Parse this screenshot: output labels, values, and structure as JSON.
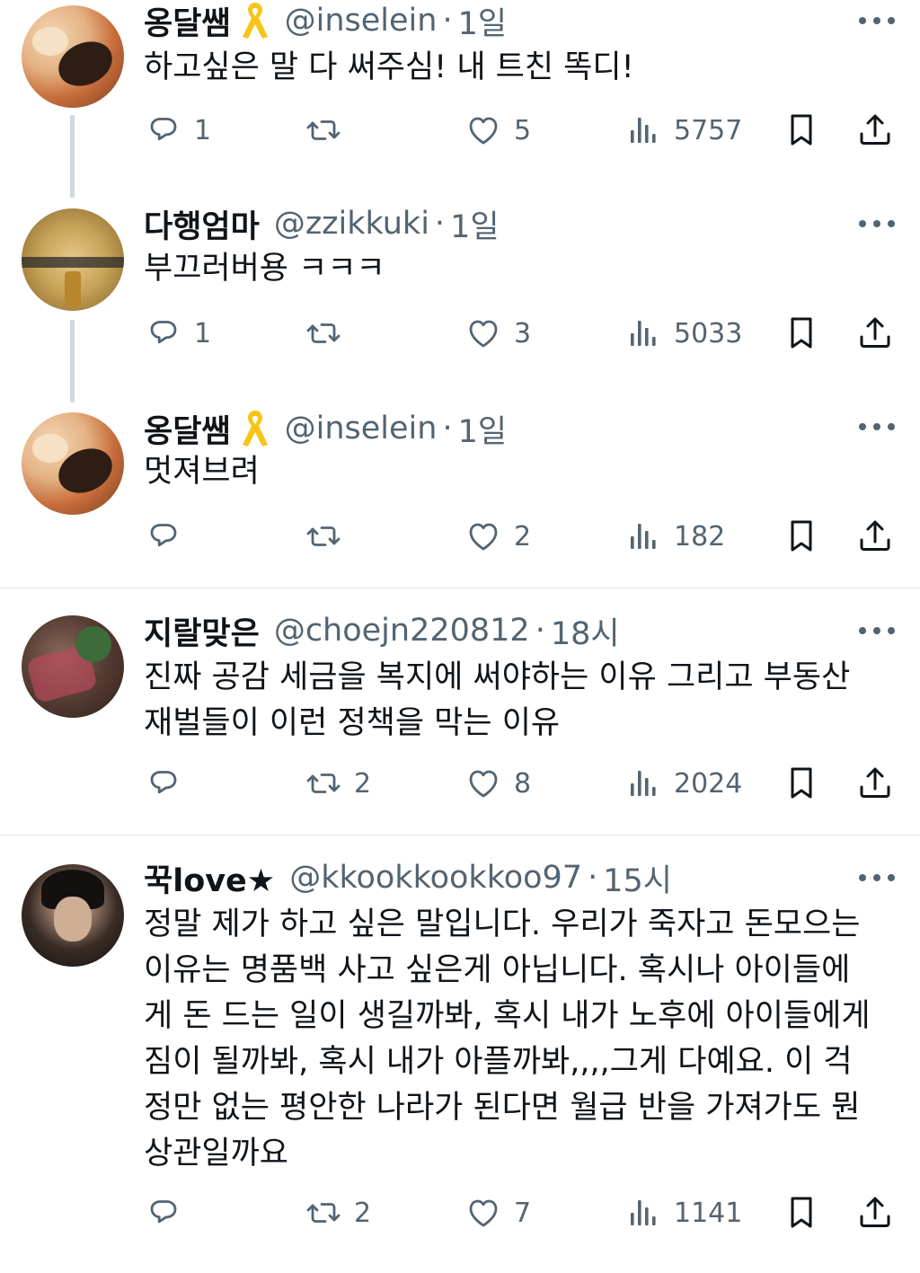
{
  "tweets": [
    {
      "name": "옹달쌤",
      "handle": "@inselein",
      "sep": "·",
      "time": "1일",
      "text": "하고싶은 말 다 써주심! 내 트친 똑디!",
      "replies": "1",
      "retweets": "",
      "likes": "5",
      "views": "5757",
      "badge": "yellow-ribbon"
    },
    {
      "name": "다행엄마",
      "handle": "@zzikkuki",
      "sep": "·",
      "time": "1일",
      "text": "부끄러버용 ㅋㅋㅋ",
      "replies": "1",
      "retweets": "",
      "likes": "3",
      "views": "5033"
    },
    {
      "name": "옹달쌤",
      "handle": "@inselein",
      "sep": "·",
      "time": "1일",
      "text": "멋져브려",
      "replies": "",
      "retweets": "",
      "likes": "2",
      "views": "182",
      "badge": "yellow-ribbon"
    },
    {
      "name": "지랄맞은",
      "handle": "@choejn220812",
      "sep": "·",
      "time": "18시",
      "text_lines": [
        "진짜 공감 세금을 복지에 써야하는 이유 그리고 부동산",
        "재벌들이 이런 정책을 막는 이유"
      ],
      "replies": "",
      "retweets": "2",
      "likes": "8",
      "views": "2024"
    },
    {
      "name": "꾹love★",
      "handle": "@kkookkookkoo97",
      "sep": "·",
      "time": "15시",
      "text_lines": [
        "정말 제가 하고 싶은 말입니다. 우리가 죽자고 돈모으는",
        "이유는 명품백 사고 싶은게 아닙니다. 혹시나 아이들에",
        "게 돈 드는 일이 생길까봐, 혹시 내가 노후에 아이들에게",
        "짐이 될까봐, 혹시 내가 아플까봐,,,,그게 다예요. 이 걱",
        "정만 없는 평안한 나라가 된다면 월급 반을 가져가도 뭔",
        "상관일까요"
      ],
      "replies": "",
      "retweets": "2",
      "likes": "7",
      "views": "1141"
    }
  ],
  "colors": {
    "text": "#0f1419",
    "secondary": "#536471",
    "divider": "#e1e5e8",
    "thread": "#cfd9de",
    "ribbon": "#f5c518"
  },
  "icons": [
    "reply-icon",
    "retweet-icon",
    "like-icon",
    "views-icon",
    "bookmark-icon",
    "share-icon",
    "more-icon",
    "yellow-ribbon-icon"
  ]
}
